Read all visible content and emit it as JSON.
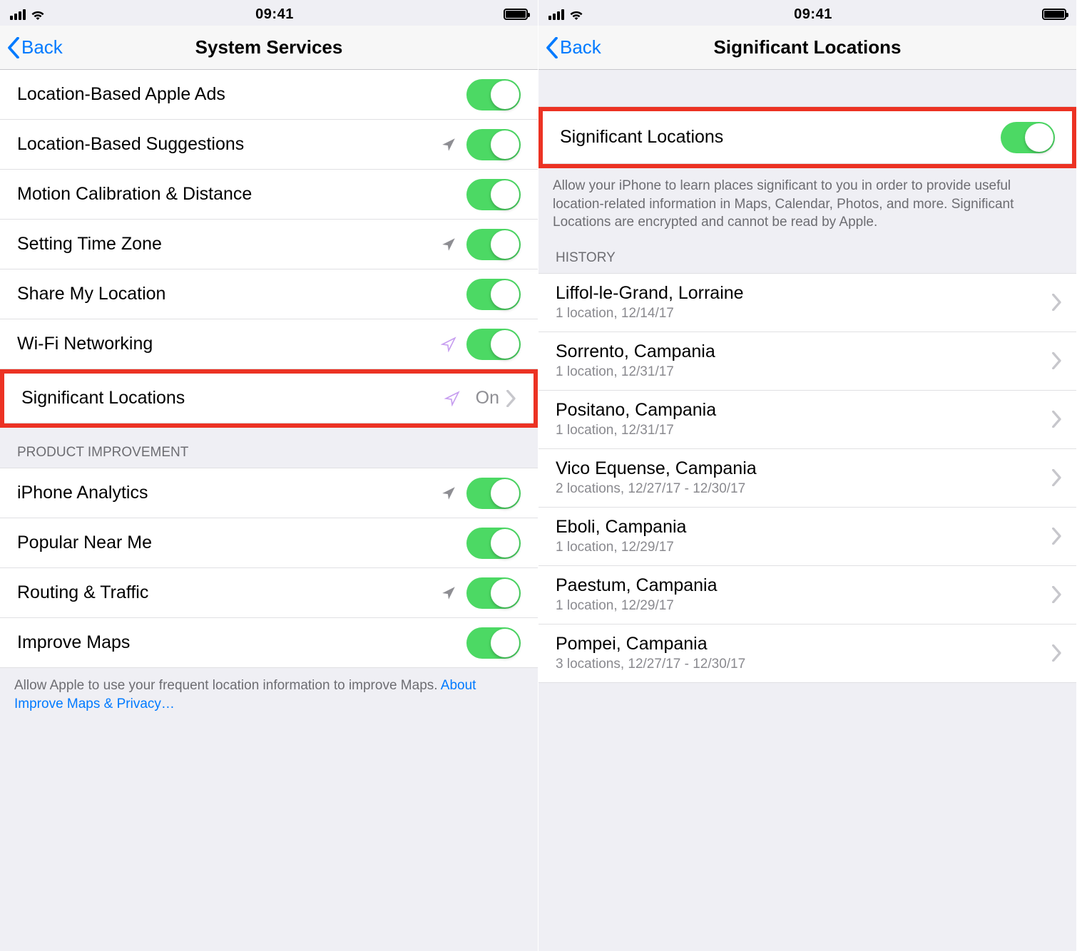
{
  "status": {
    "time": "09:41"
  },
  "left": {
    "back_label": "Back",
    "title": "System Services",
    "rows": [
      {
        "label": "Location-Based Apple Ads",
        "toggle": true
      },
      {
        "label": "Location-Based Suggestions",
        "toggle": true,
        "loc_icon": "gray"
      },
      {
        "label": "Motion Calibration & Distance",
        "toggle": true
      },
      {
        "label": "Setting Time Zone",
        "toggle": true,
        "loc_icon": "gray"
      },
      {
        "label": "Share My Location",
        "toggle": true
      },
      {
        "label": "Wi-Fi Networking",
        "toggle": true,
        "loc_icon": "purple"
      },
      {
        "label": "Significant Locations",
        "value": "On",
        "loc_icon": "purple-outline",
        "chevron": true,
        "highlight": true
      }
    ],
    "section2_header": "Product Improvement",
    "rows2": [
      {
        "label": "iPhone Analytics",
        "toggle": true,
        "loc_icon": "gray"
      },
      {
        "label": "Popular Near Me",
        "toggle": true
      },
      {
        "label": "Routing & Traffic",
        "toggle": true,
        "loc_icon": "gray"
      },
      {
        "label": "Improve Maps",
        "toggle": true
      }
    ],
    "footer_text": "Allow Apple to use your frequent location information to improve Maps. ",
    "footer_link": "About Improve Maps & Privacy…"
  },
  "right": {
    "back_label": "Back",
    "title": "Significant Locations",
    "main_toggle_label": "Significant Locations",
    "main_toggle_on": true,
    "description": "Allow your iPhone to learn places significant to you in order to provide useful location-related information in Maps, Calendar, Photos, and more. Significant Locations are encrypted and cannot be read by Apple.",
    "history_header": "History",
    "history": [
      {
        "title": "Liffol-le-Grand, Lorraine",
        "detail": "1 location, 12/14/17"
      },
      {
        "title": "Sorrento, Campania",
        "detail": "1 location, 12/31/17"
      },
      {
        "title": "Positano, Campania",
        "detail": "1 location, 12/31/17"
      },
      {
        "title": "Vico Equense, Campania",
        "detail": "2 locations, 12/27/17 - 12/30/17"
      },
      {
        "title": "Eboli, Campania",
        "detail": "1 location, 12/29/17"
      },
      {
        "title": "Paestum, Campania",
        "detail": "1 location, 12/29/17"
      },
      {
        "title": "Pompei, Campania",
        "detail": "3 locations, 12/27/17 - 12/30/17"
      }
    ]
  }
}
